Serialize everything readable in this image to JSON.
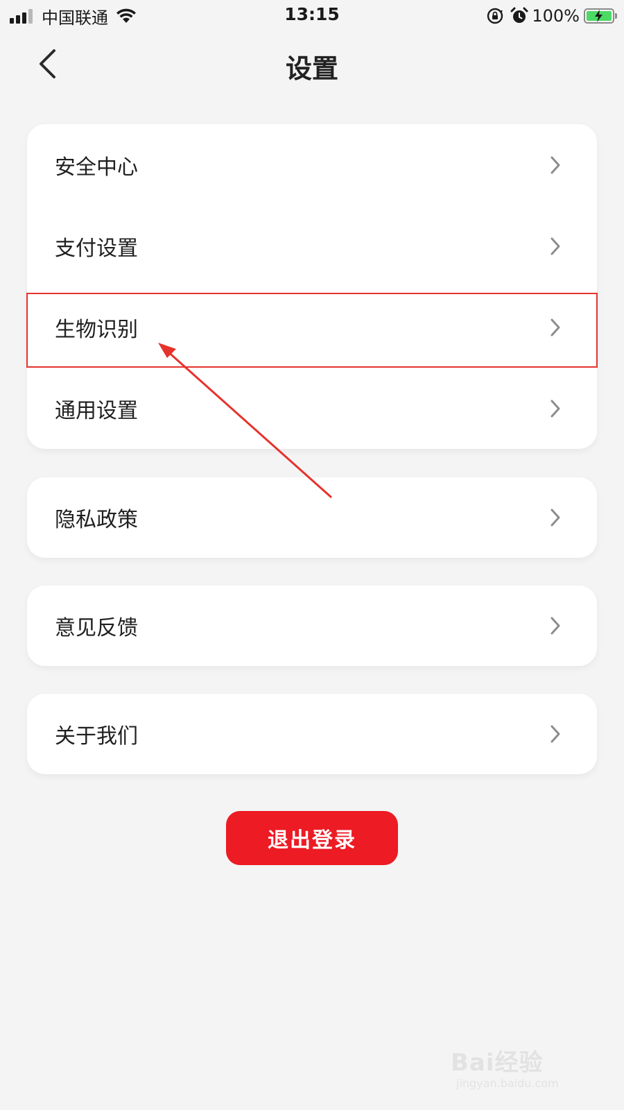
{
  "status_bar": {
    "carrier": "中国联通",
    "time": "13:15",
    "battery": "100%",
    "battery_level": 1.0,
    "icons": [
      "signal-icon",
      "wifi-icon",
      "orientation-lock-icon",
      "alarm-icon",
      "battery-icon"
    ]
  },
  "nav": {
    "title": "设置",
    "back_icon": "chevron-left-icon"
  },
  "groups": [
    {
      "items": [
        {
          "label": "安全中心"
        },
        {
          "label": "支付设置"
        },
        {
          "label": "生物识别"
        },
        {
          "label": "通用设置"
        }
      ]
    },
    {
      "items": [
        {
          "label": "隐私政策"
        }
      ]
    },
    {
      "items": [
        {
          "label": "意见反馈"
        }
      ]
    },
    {
      "items": [
        {
          "label": "关于我们"
        }
      ]
    }
  ],
  "logout": {
    "label": "退出登录"
  },
  "annotation": {
    "highlighted_item": "生物识别",
    "color": "#e5322c"
  },
  "watermark": {
    "brand": "Bai经验",
    "url": "jingyan.baidu.com"
  },
  "colors": {
    "background": "#f5f4f5",
    "card": "#ffffff",
    "accent": "#ec1b24",
    "chevron": "#8c8c8c"
  }
}
